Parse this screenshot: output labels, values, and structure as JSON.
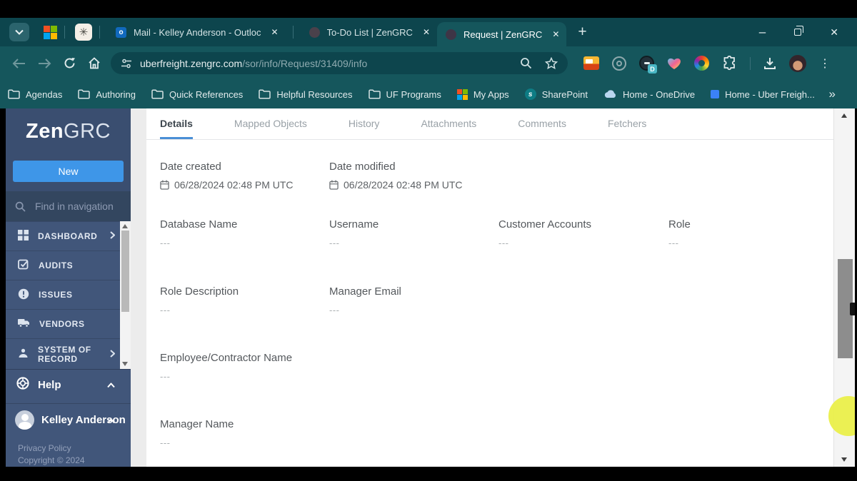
{
  "browser": {
    "tabs": [
      {
        "title": "Mail - Kelley Anderson - Outloc",
        "close": "✕"
      },
      {
        "title": "To-Do List | ZenGRC",
        "close": "✕"
      },
      {
        "title": "Request | ZenGRC",
        "close": "✕"
      }
    ],
    "new_tab": "+",
    "minimize": "–",
    "close": "✕",
    "url_domain": "uberfreight.zengrc.com",
    "url_path": "/sor/info/Request/31409/info",
    "bookmarks": [
      {
        "label": "Agendas"
      },
      {
        "label": "Authoring"
      },
      {
        "label": "Quick References"
      },
      {
        "label": "Helpful Resources"
      },
      {
        "label": "UF Programs"
      },
      {
        "label": "My Apps"
      },
      {
        "label": "SharePoint"
      },
      {
        "label": "Home - OneDrive"
      },
      {
        "label": "Home - Uber Freigh..."
      }
    ],
    "bookmarks_overflow": "»",
    "menu_dots": "⋮"
  },
  "sidebar": {
    "logo_bold": "Zen",
    "logo_light": "GRC",
    "new_button": "New",
    "find_placeholder": "Find in navigation",
    "items": [
      {
        "label": "DASHBOARD"
      },
      {
        "label": "AUDITS"
      },
      {
        "label": "ISSUES"
      },
      {
        "label": "VENDORS"
      },
      {
        "label": "SYSTEM OF RECORD"
      }
    ],
    "help_label": "Help",
    "user_name": "Kelley Anderson",
    "privacy_link": "Privacy Policy",
    "copyright": "Copyright © 2024"
  },
  "content": {
    "tabs": [
      {
        "label": "Details"
      },
      {
        "label": "Mapped Objects"
      },
      {
        "label": "History"
      },
      {
        "label": "Attachments"
      },
      {
        "label": "Comments"
      },
      {
        "label": "Fetchers"
      }
    ],
    "active_tab": "Details",
    "fields": {
      "date_created": {
        "label": "Date created",
        "value": "06/28/2024 02:48 PM UTC"
      },
      "date_modified": {
        "label": "Date modified",
        "value": "06/28/2024 02:48 PM UTC"
      },
      "database_name": {
        "label": "Database Name",
        "value": "---"
      },
      "username": {
        "label": "Username",
        "value": "---"
      },
      "customer_accounts": {
        "label": "Customer Accounts",
        "value": "---"
      },
      "role": {
        "label": "Role",
        "value": "---"
      },
      "role_description": {
        "label": "Role Description",
        "value": "---"
      },
      "manager_email": {
        "label": "Manager Email",
        "value": "---"
      },
      "employee_contractor_name": {
        "label": "Employee/Contractor Name",
        "value": "---"
      },
      "manager_name": {
        "label": "Manager Name",
        "value": "---"
      }
    }
  },
  "colors": {
    "chrome_teal": "#15565c",
    "chrome_dark_teal": "#0d454d",
    "sidebar_navy": "#41567a",
    "accent_blue": "#3e96e8",
    "tab_underline": "#4a8fd6",
    "highlight_yellow": "#e9ef44"
  }
}
